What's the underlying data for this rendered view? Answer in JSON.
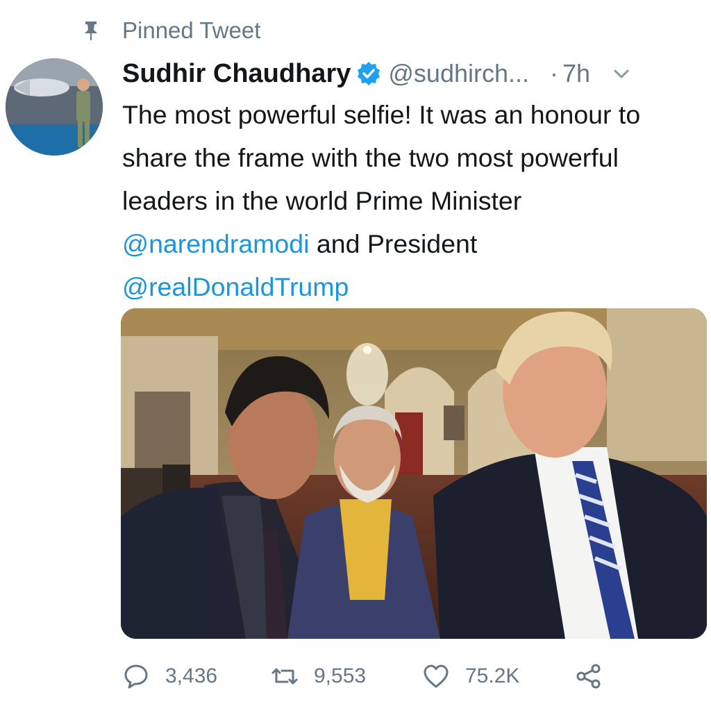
{
  "pinned": {
    "label": "Pinned Tweet",
    "icon": "pin-icon"
  },
  "author": {
    "display_name": "Sudhir Chaudhary",
    "verified": true,
    "handle": "@sudhirch...",
    "separator": "·",
    "time": "7h"
  },
  "tweet": {
    "text_part1": "The most powerful selfie! It was an honour to share the frame with the two most powerful leaders in the world Prime Minister ",
    "mention1": "@narendramodi",
    "text_part2": " and President ",
    "mention2": "@realDonaldTrump"
  },
  "actions": {
    "replies": "3,436",
    "retweets": "9,553",
    "likes": "75.2K"
  },
  "colors": {
    "link": "#1b95e0",
    "secondary_text": "#657786",
    "verified": "#1da1f2"
  }
}
